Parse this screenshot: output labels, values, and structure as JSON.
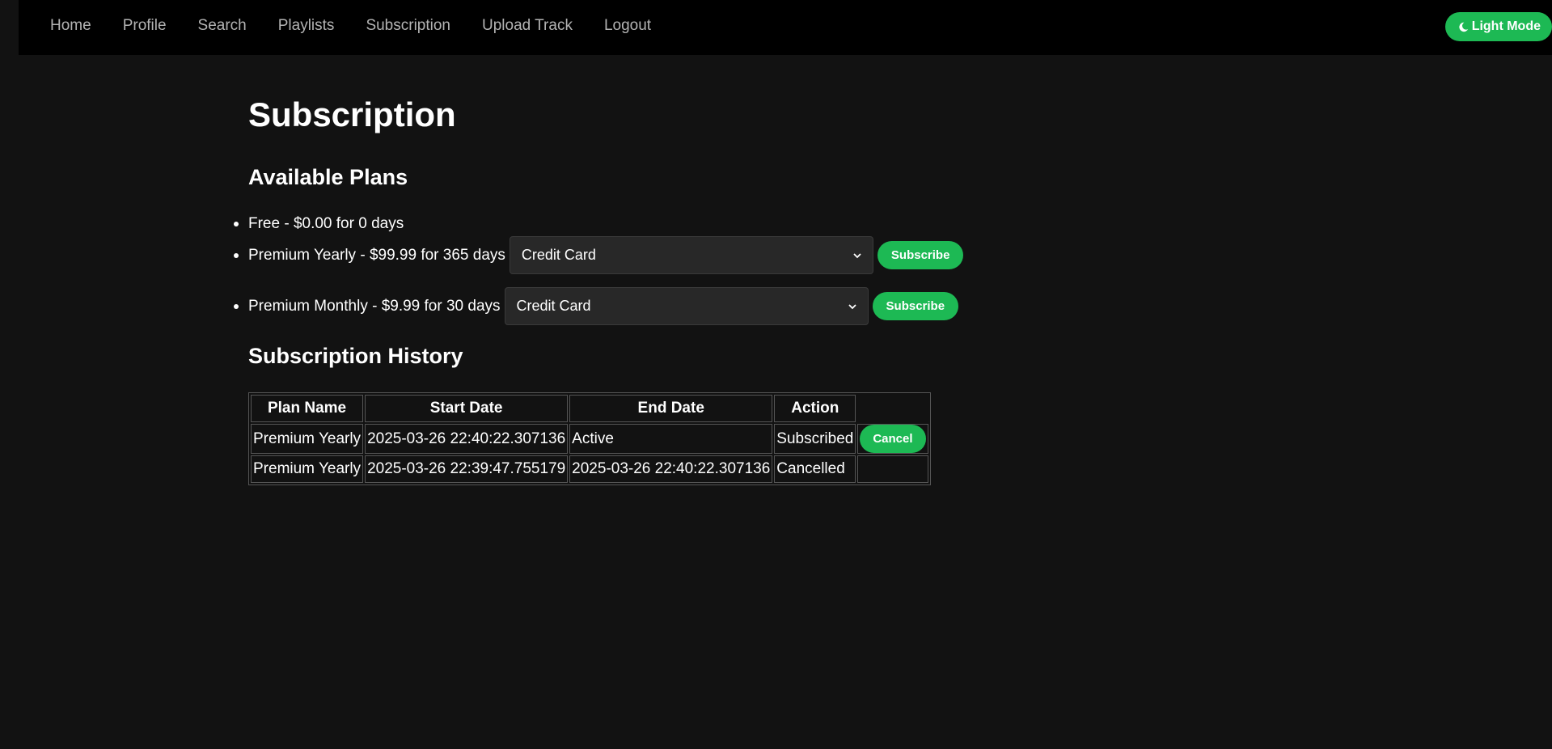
{
  "nav": {
    "links": [
      "Home",
      "Profile",
      "Search",
      "Playlists",
      "Subscription",
      "Upload Track",
      "Logout"
    ],
    "theme_toggle": "Light Mode",
    "theme_icon": "moon-icon"
  },
  "page": {
    "title": "Subscription"
  },
  "plans": {
    "heading": "Available Plans",
    "items": [
      {
        "label": "Free - $0.00 for 0 days"
      },
      {
        "label": "Premium Yearly - $99.99 for 365 days",
        "payment_method": "Credit Card",
        "button": "Subscribe"
      },
      {
        "label": "Premium Monthly - $9.99 for 30 days",
        "payment_method": "Credit Card",
        "button": "Subscribe"
      }
    ]
  },
  "history": {
    "heading": "Subscription History",
    "columns": [
      "Plan Name",
      "Start Date",
      "End Date",
      "Action"
    ],
    "rows": [
      {
        "plan": "Premium Yearly",
        "start": "2025-03-26 22:40:22.307136",
        "end": "Active",
        "status": "Subscribed",
        "action_button": "Cancel"
      },
      {
        "plan": "Premium Yearly",
        "start": "2025-03-26 22:39:47.755179",
        "end": "2025-03-26 22:40:22.307136",
        "status": "Cancelled"
      }
    ]
  },
  "colors": {
    "accent": "#1db954",
    "background": "#121212",
    "navbar": "#000000"
  }
}
